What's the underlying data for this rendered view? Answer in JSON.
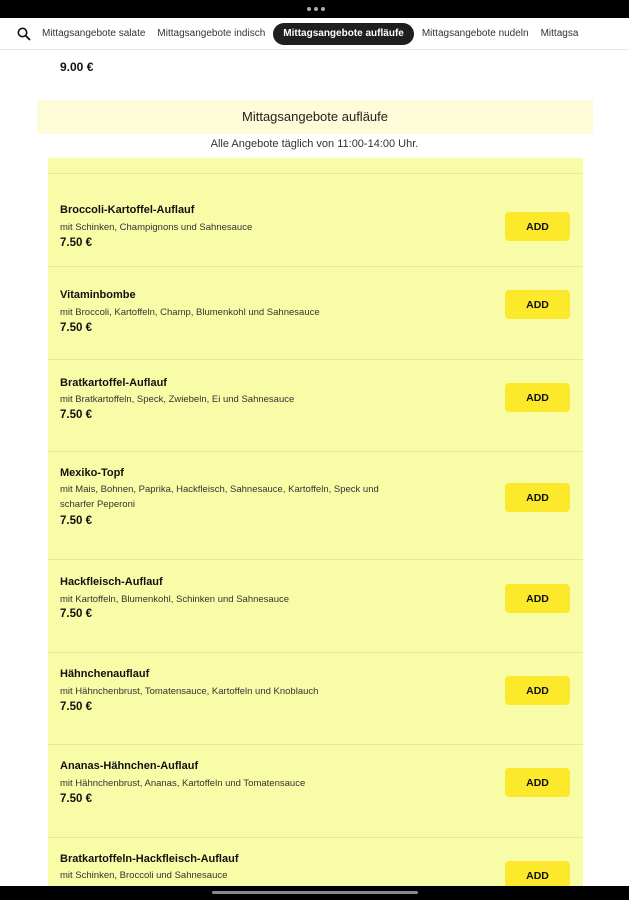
{
  "categories": [
    {
      "label": "Mittagsangebote salate",
      "active": false
    },
    {
      "label": "Mittagsangebote indisch",
      "active": false
    },
    {
      "label": "Mittagsangebote aufläufe",
      "active": true
    },
    {
      "label": "Mittagsangebote nudeln",
      "active": false
    },
    {
      "label": "Mittagsa",
      "active": false
    }
  ],
  "prev_item_price": "9.00 €",
  "section": {
    "title": "Mittagsangebote aufläufe",
    "subtitle": "Alle Angebote täglich von 11:00-14:00 Uhr."
  },
  "add_label": "ADD",
  "items": [
    {
      "name": "Broccoli-Kartoffel-Auflauf",
      "desc": "mit Schinken, Champignons und Sahnesauce",
      "price": "7.50 €"
    },
    {
      "name": "Vitaminbombe",
      "desc": "mit Broccoli, Kartoffeln, Champ, Blumenkohl und Sahnesauce",
      "price": "7.50 €"
    },
    {
      "name": "Bratkartoffel-Auflauf",
      "desc": "mit Bratkartoffeln, Speck, Zwiebeln, Ei und Sahnesauce",
      "price": "7.50 €"
    },
    {
      "name": "Mexiko-Topf",
      "desc": "mit Mais, Bohnen, Paprika, Hackfleisch, Sahnesauce, Kartoffeln, Speck und scharfer Peperoni",
      "price": "7.50 €"
    },
    {
      "name": "Hackfleisch-Auflauf",
      "desc": "mit Kartoffeln, Blumenkohl, Schinken und Sahnesauce",
      "price": "7.50 €"
    },
    {
      "name": "Hähnchenauflauf",
      "desc": "mit Hähnchenbrust, Tomatensauce, Kartoffeln und Knoblauch",
      "price": "7.50 €"
    },
    {
      "name": "Ananas-Hähnchen-Auflauf",
      "desc": "mit Hähnchenbrust, Ananas, Kartoffeln und Tomatensauce",
      "price": "7.50 €"
    },
    {
      "name": "Bratkartoffeln-Hackfleisch-Auflauf",
      "desc": "mit Schinken, Broccoli und Sahnesauce",
      "price": ""
    }
  ]
}
